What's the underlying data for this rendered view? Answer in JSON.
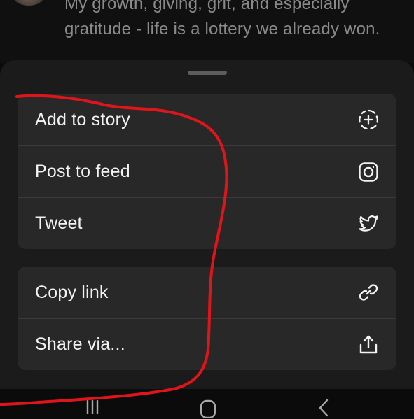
{
  "post": {
    "text_line_1": "My growth, giving, grit, and especially",
    "text_line_2": "gratitude - life is a lottery we already won."
  },
  "share_sheet": {
    "group_1": [
      {
        "label": "Add to story",
        "icon": "add-circle-dashed-icon"
      },
      {
        "label": "Post to feed",
        "icon": "instagram-icon"
      },
      {
        "label": "Tweet",
        "icon": "twitter-bird-icon"
      }
    ],
    "group_2": [
      {
        "label": "Copy link",
        "icon": "link-icon"
      },
      {
        "label": "Share via...",
        "icon": "share-upload-icon"
      }
    ]
  },
  "navbar": {
    "recents_icon": "recents-icon",
    "home_icon": "home-icon",
    "back_icon": "back-icon"
  },
  "colors": {
    "sheet_background": "#1b1b1b",
    "group_background": "#282828",
    "text_primary": "#f2f2f2",
    "annotation_red": "#e0151c"
  }
}
